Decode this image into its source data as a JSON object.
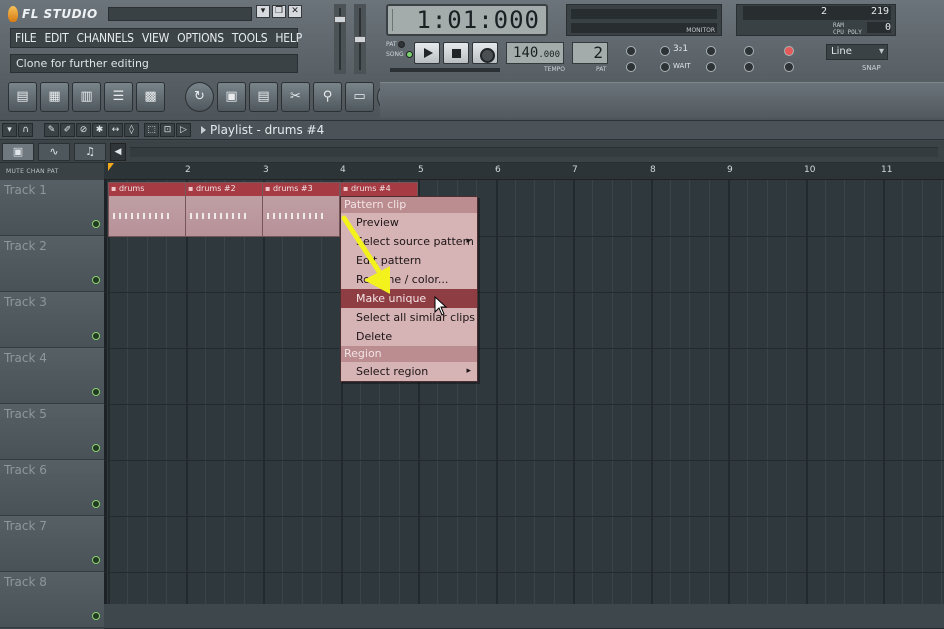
{
  "app": {
    "logo": "FL STUDIO",
    "win_buttons": [
      "▾",
      "❐",
      "✕"
    ],
    "menu": [
      "FILE",
      "EDIT",
      "CHANNELS",
      "VIEW",
      "OPTIONS",
      "TOOLS",
      "HELP"
    ],
    "hint": "Clone for further editing"
  },
  "transport": {
    "time": "1:01:000",
    "pat_label": "PAT",
    "song_label": "SONG",
    "tempo_int": "140",
    "tempo_dec": ".000",
    "tempo_label": "TEMPO",
    "pattern": "2",
    "pattern_label": "PAT",
    "monitor_label": "MONITOR"
  },
  "cpu": {
    "a": "2",
    "b": "219",
    "ram_label": "RAM",
    "cpu_label": "CPU",
    "poly_label": "POLY",
    "poly": "0"
  },
  "snap": {
    "value": "Line",
    "label": "SNAP"
  },
  "record_icons": [
    "3₂1",
    "WAIT"
  ],
  "playlist": {
    "title": "Playlist - drums #4",
    "col_header": "MUTE CHAN PAT",
    "ruler": [
      "2",
      "3",
      "4",
      "5",
      "6",
      "7",
      "8",
      "9",
      "10",
      "11"
    ],
    "tracks": [
      "Track 1",
      "Track 2",
      "Track 3",
      "Track 4",
      "Track 5",
      "Track 6",
      "Track 7",
      "Track 8"
    ],
    "clips": [
      "drums",
      "drums #2",
      "drums #3",
      "drums #4"
    ]
  },
  "context_menu": {
    "section1": "Pattern clip",
    "items1": [
      "Preview",
      "Select source pattern",
      "Edit pattern",
      "Rename / color...",
      "Make unique",
      "Select all similar clips",
      "Delete"
    ],
    "section2": "Region",
    "items2": [
      "Select region"
    ],
    "selected": "Make unique"
  },
  "colors": {
    "accent_arrow": "#f3f21d",
    "clip_header": "#a63b43",
    "menu_bg": "#d6b3b5",
    "menu_selected": "#8e3d43"
  }
}
